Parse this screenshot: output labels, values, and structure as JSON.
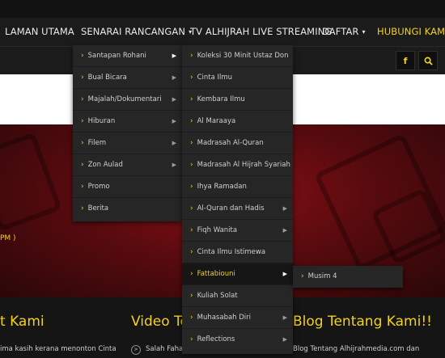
{
  "nav": {
    "items": [
      {
        "label": "LAMAN UTAMA"
      },
      {
        "label": "SENARAI RANCANGAN",
        "caret": "▾"
      },
      {
        "label": "TV ALHIJRAH LIVE STREAMING"
      },
      {
        "label": "DAFTAR",
        "caret": "▾"
      },
      {
        "label": "HUBUNGI KAMI"
      }
    ]
  },
  "social": {
    "facebook": "f",
    "search": "search-icon"
  },
  "menu1": [
    {
      "label": "Santapan Rohani",
      "arrow": "▶"
    },
    {
      "label": "Bual Bicara",
      "arrow": "▶"
    },
    {
      "label": "Majalah/Dokumentari",
      "arrow": "▶"
    },
    {
      "label": "Hiburan",
      "arrow": "▶"
    },
    {
      "label": "Filem",
      "arrow": "▶"
    },
    {
      "label": "Zon Aulad",
      "arrow": "▶"
    },
    {
      "label": "Promo",
      "arrow": ""
    },
    {
      "label": "Berita",
      "arrow": ""
    }
  ],
  "menu2": [
    {
      "label": "Koleksi 30 Minit Ustaz Don",
      "arrow": ""
    },
    {
      "label": "Cinta Ilmu",
      "arrow": ""
    },
    {
      "label": "Kembara Ilmu",
      "arrow": ""
    },
    {
      "label": "Al Maraaya",
      "arrow": ""
    },
    {
      "label": "Madrasah Al-Quran",
      "arrow": ""
    },
    {
      "label": "Madrasah Al Hijrah Syariah",
      "arrow": ""
    },
    {
      "label": "Ihya Ramadan",
      "arrow": ""
    },
    {
      "label": "Al-Quran dan Hadis",
      "arrow": "▶"
    },
    {
      "label": "Fiqh Wanita",
      "arrow": "▶"
    },
    {
      "label": "Cinta Ilmu Istimewa",
      "arrow": ""
    },
    {
      "label": "Fattabiouni",
      "arrow": "▶"
    },
    {
      "label": "Kuliah Solat",
      "arrow": ""
    },
    {
      "label": "Muhasabah Diri",
      "arrow": "▶"
    },
    {
      "label": "Reflections",
      "arrow": "▶"
    }
  ],
  "menu3": [
    {
      "label": "Musim 4",
      "arrow": ""
    }
  ],
  "hero": {
    "text": "PM )"
  },
  "footer": {
    "col1_title": "t Kami",
    "col1_text": "ima kasih kerana menonton Cinta",
    "col2_title": "Video Te",
    "col2_text": "Salah Faha",
    "col3_title": "Blog Tentang Kami!!",
    "col3_text": "Blog Tentang Alhijrahmedia.com dan"
  },
  "colors": {
    "accent": "#f2d21b",
    "menu_bg": "#262626",
    "hero": "#8a1016"
  }
}
